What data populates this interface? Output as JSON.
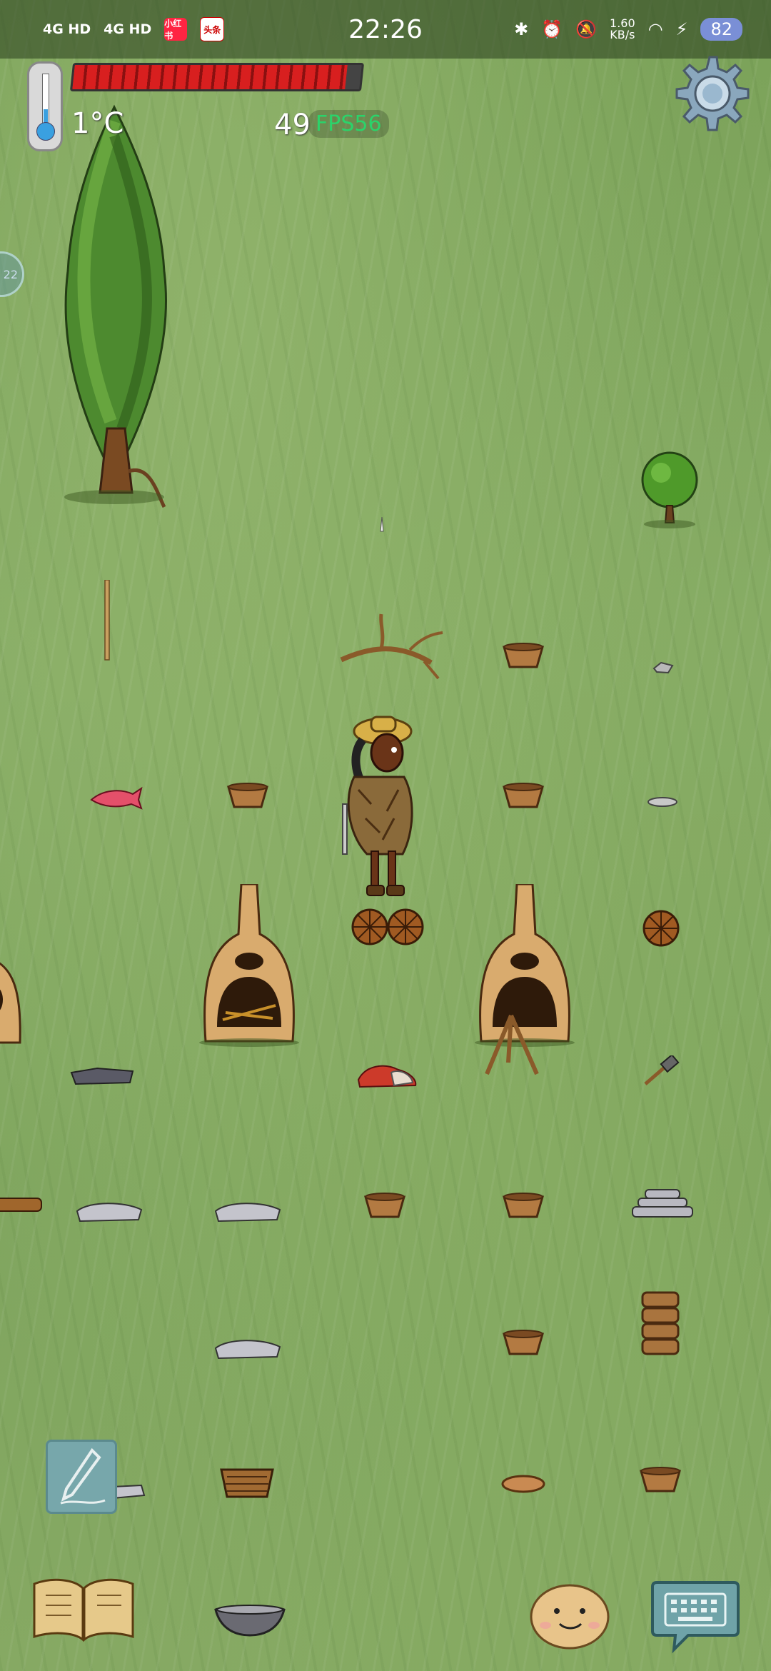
{
  "status_bar": {
    "time": "22:26",
    "signal_1": "4G HD",
    "signal_2": "4G HD",
    "app_icons": [
      "小红书",
      "头条"
    ],
    "net_speed_value": "1.60",
    "net_speed_unit": "KB/s",
    "battery": "82"
  },
  "hud": {
    "temperature": "1°C",
    "food_level": 0.95,
    "yum_count": "49",
    "fps_label": "FPS56",
    "side_bubble_text": "22"
  },
  "icons": [
    "thermometer-icon",
    "gear-icon",
    "pencil-icon",
    "book-icon",
    "bowl-icon",
    "emote-face-icon",
    "keyboard-icon"
  ],
  "colors": {
    "grass": "#7fa35c",
    "food_bar": "#d81f1f",
    "fps_text": "#2bd36a",
    "note_button": "#77a7ab"
  },
  "world_objects": [
    "juniper-tree",
    "bush",
    "stake",
    "branch",
    "basket",
    "flint",
    "clay-plate",
    "rabbit-hide",
    "kiln",
    "stone",
    "hammer",
    "rubber-ball",
    "stack-of-stones",
    "character"
  ]
}
